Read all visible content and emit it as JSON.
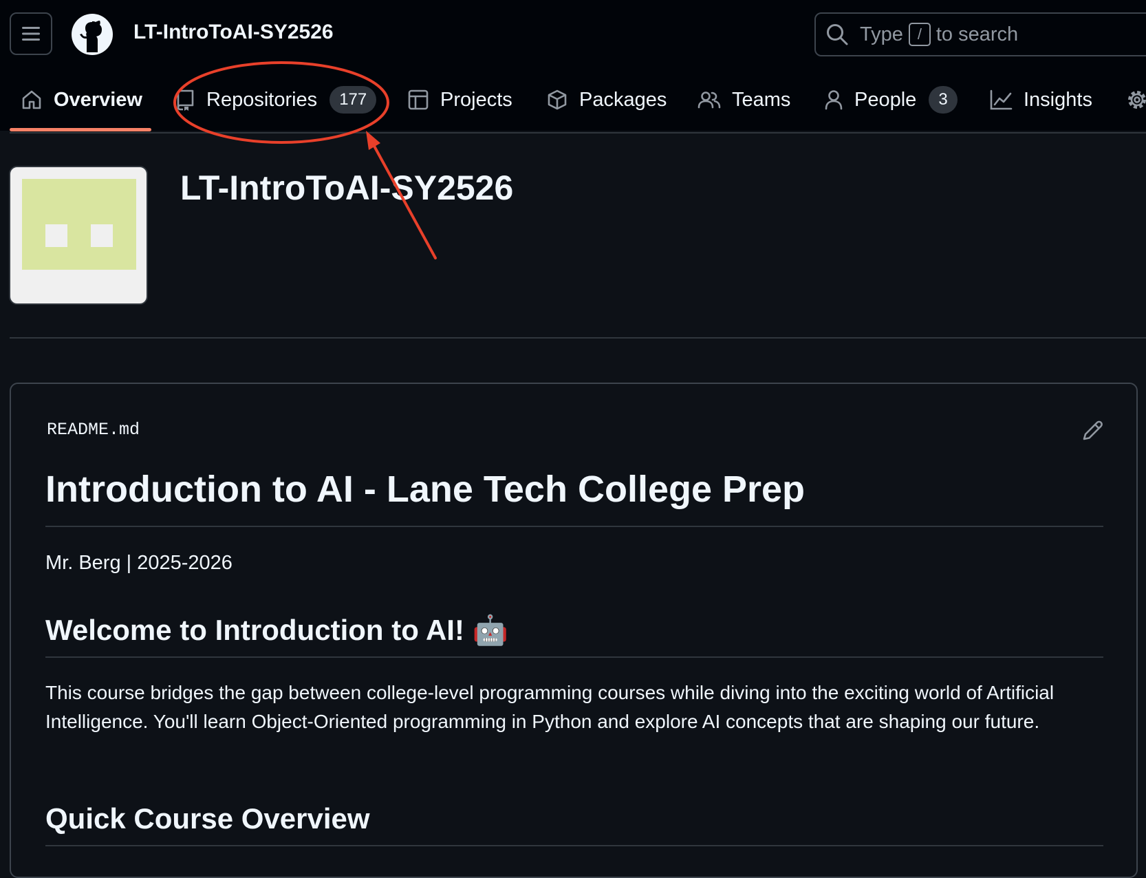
{
  "header": {
    "org_name": "LT-IntroToAI-SY2526",
    "search": {
      "prefix": "Type",
      "key": "/",
      "suffix": "to search"
    }
  },
  "nav": {
    "tabs": [
      {
        "label": "Overview",
        "icon": "home-icon",
        "selected": true
      },
      {
        "label": "Repositories",
        "icon": "repo-icon",
        "count": "177"
      },
      {
        "label": "Projects",
        "icon": "table-icon"
      },
      {
        "label": "Packages",
        "icon": "package-icon"
      },
      {
        "label": "Teams",
        "icon": "people-icon"
      },
      {
        "label": "People",
        "icon": "person-icon",
        "count": "3"
      },
      {
        "label": "Insights",
        "icon": "graph-icon"
      }
    ],
    "settings_icon": "gear-icon"
  },
  "org": {
    "title": "LT-IntroToAI-SY2526",
    "avatar_colors": {
      "background": "#f0f0f0",
      "pattern": "#d9e5a0"
    }
  },
  "readme": {
    "filename": "README.md",
    "title": "Introduction to AI - Lane Tech College Prep",
    "byline": "Mr. Berg | 2025-2026",
    "welcome_heading": "Welcome to Introduction to AI!",
    "welcome_emoji": "🤖",
    "description": "This course bridges the gap between college-level programming courses while diving into the exciting world of Artificial Intelligence. You'll learn Object-Oriented programming in Python and explore AI concepts that are shaping our future.",
    "overview_heading": "Quick Course Overview"
  },
  "colors": {
    "accent_underline": "#f78166",
    "annotation": "#e8402a",
    "page_bg": "#0d1117",
    "header_bg": "#010409"
  }
}
